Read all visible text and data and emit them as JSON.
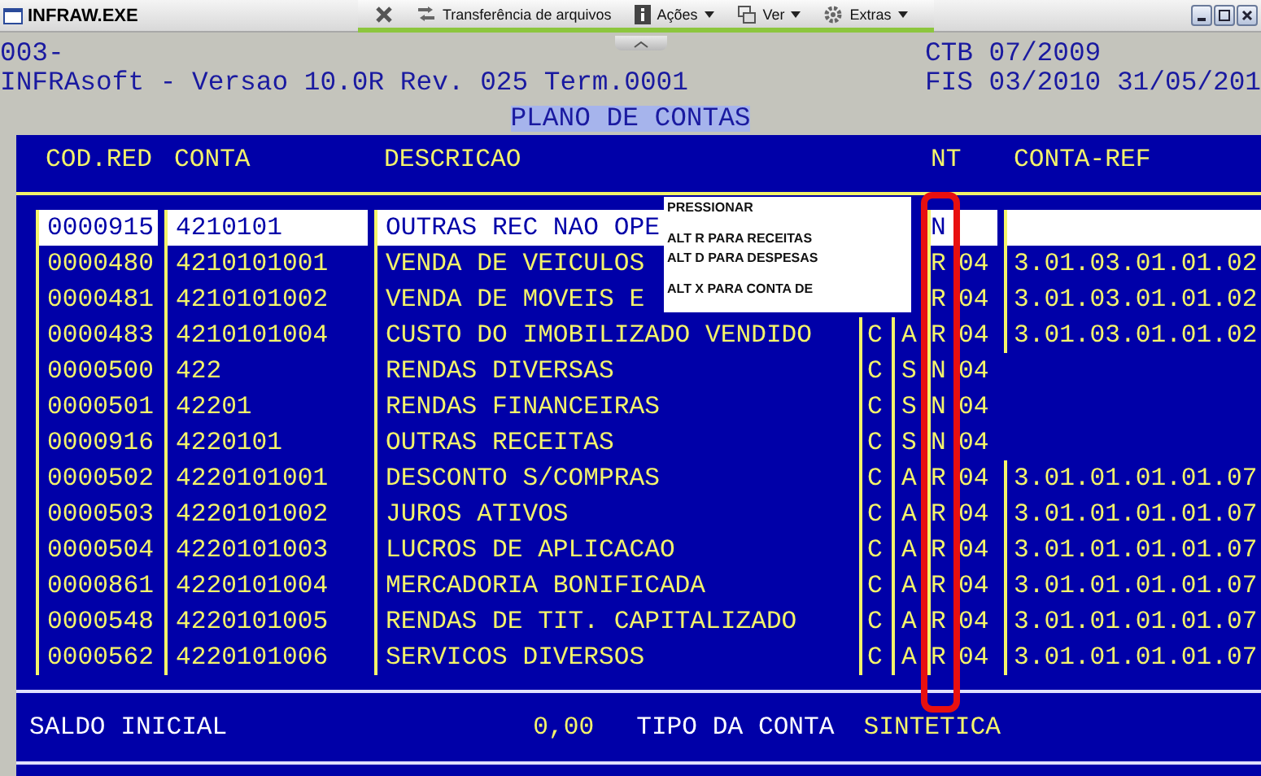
{
  "window": {
    "title": "INFRAW.EXE"
  },
  "remote_toolbar": {
    "items": [
      {
        "kind": "close"
      },
      {
        "kind": "transfer",
        "label": "Transferência de arquivos"
      },
      {
        "kind": "actions",
        "label": "Ações"
      },
      {
        "kind": "view",
        "label": "Ver"
      },
      {
        "kind": "extras",
        "label": "Extras"
      }
    ]
  },
  "header": {
    "left_lines": [
      "003-",
      "INFRAsoft - Versao 10.0R Rev. 025 Term.0001"
    ],
    "right_lines": [
      "CTB 07/2009",
      "FIS 03/2010 31/05/201"
    ],
    "screen_title": "PLANO DE CONTAS"
  },
  "table": {
    "columns": [
      "COD.RED",
      "CONTA",
      "DESCRICAO",
      "NT",
      "CONTA-REF"
    ],
    "rows": [
      {
        "cod": "0000915",
        "conta": "4210101",
        "descricao": "OUTRAS REC NAO OPE",
        "r": "N",
        "selected": true
      },
      {
        "cod": "0000480",
        "conta": "4210101001",
        "descricao": "VENDA DE VEICULOS",
        "r": "R",
        "nt": "04",
        "ref": "3.01.03.01.01.02",
        "selected": false
      },
      {
        "cod": "0000481",
        "conta": "4210101002",
        "descricao": "VENDA DE MOVEIS E",
        "r": "R",
        "nt": "04",
        "ref": "3.01.03.01.01.02",
        "selected": false
      },
      {
        "cod": "0000483",
        "conta": "4210101004",
        "descricao": "CUSTO DO IMOBILIZADO VENDIDO",
        "c": "C",
        "a": "A",
        "r": "R",
        "nt": "04",
        "ref": "3.01.03.01.01.02",
        "selected": false
      },
      {
        "cod": "0000500",
        "conta": "422",
        "descricao": "RENDAS DIVERSAS",
        "c": "C",
        "a": "S",
        "r": "N",
        "nt": "04",
        "selected": false
      },
      {
        "cod": "0000501",
        "conta": "42201",
        "descricao": "RENDAS FINANCEIRAS",
        "c": "C",
        "a": "S",
        "r": "N",
        "nt": "04",
        "selected": false
      },
      {
        "cod": "0000916",
        "conta": "4220101",
        "descricao": "OUTRAS RECEITAS",
        "c": "C",
        "a": "S",
        "r": "N",
        "nt": "04",
        "selected": false
      },
      {
        "cod": "0000502",
        "conta": "4220101001",
        "descricao": "DESCONTO S/COMPRAS",
        "c": "C",
        "a": "A",
        "r": "R",
        "nt": "04",
        "ref": "3.01.01.01.01.07",
        "selected": false
      },
      {
        "cod": "0000503",
        "conta": "4220101002",
        "descricao": "JUROS ATIVOS",
        "c": "C",
        "a": "A",
        "r": "R",
        "nt": "04",
        "ref": "3.01.01.01.01.07",
        "selected": false
      },
      {
        "cod": "0000504",
        "conta": "4220101003",
        "descricao": "LUCROS DE APLICACAO",
        "c": "C",
        "a": "A",
        "r": "R",
        "nt": "04",
        "ref": "3.01.01.01.01.07",
        "selected": false
      },
      {
        "cod": "0000861",
        "conta": "4220101004",
        "descricao": "MERCADORIA BONIFICADA",
        "c": "C",
        "a": "A",
        "r": "R",
        "nt": "04",
        "ref": "3.01.01.01.01.07",
        "selected": false
      },
      {
        "cod": "0000548",
        "conta": "4220101005",
        "descricao": "RENDAS DE TIT. CAPITALIZADO",
        "c": "C",
        "a": "A",
        "r": "R",
        "nt": "04",
        "ref": "3.01.01.01.01.07",
        "selected": false
      },
      {
        "cod": "0000562",
        "conta": "4220101006",
        "descricao": "SERVICOS DIVERSOS",
        "c": "C",
        "a": "A",
        "r": "R",
        "nt": "04",
        "ref": "3.01.01.01.01.07",
        "selected": false
      }
    ]
  },
  "popup": {
    "groups": [
      [
        "PRESSIONAR"
      ],
      [
        "ALT R PARA RECEITAS",
        "ALT D PARA DESPESAS"
      ],
      [
        "ALT X PARA CONTA DE"
      ]
    ]
  },
  "footer": {
    "saldo_label": "SALDO INICIAL",
    "saldo_value": "0,00",
    "tipo_label": "TIPO DA CONTA",
    "tipo_value": "SINTETICA"
  }
}
